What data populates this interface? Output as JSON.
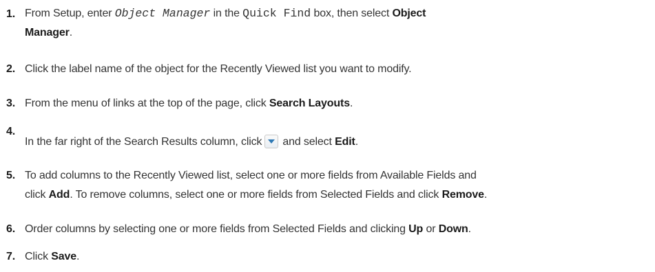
{
  "steps": [
    {
      "num": "1.",
      "line1": {
        "t1": "From Setup, enter ",
        "mono_italic": "Object Manager",
        "t2": " in the ",
        "mono": "Quick Find",
        "t3": " box, then select ",
        "bold": "Object"
      },
      "line2": {
        "bold": "Manager",
        "t1": "."
      }
    },
    {
      "num": "2.",
      "text": "Click the label name of the object for the Recently Viewed list you want to modify."
    },
    {
      "num": "3.",
      "t1": "From the menu of links at the top of the page, click ",
      "bold": "Search Layouts",
      "t2": "."
    },
    {
      "num": "4.",
      "t1": "In the far right of the Search Results column, click",
      "icon": "dropdown-arrow-icon",
      "t2": "and select ",
      "bold": "Edit",
      "t3": "."
    },
    {
      "num": "5.",
      "line1": {
        "t1": "To add columns to the Recently Viewed list, select one or more fields from Available Fields and"
      },
      "line2": {
        "t1": "click ",
        "bold1": "Add",
        "t2": ". To remove columns, select one or more fields from Selected Fields and click ",
        "bold2": "Remove",
        "t3": "."
      }
    },
    {
      "num": "6.",
      "t1": "Order columns by selecting one or more fields from Selected Fields and clicking ",
      "bold1": "Up",
      "t2": " or ",
      "bold2": "Down",
      "t3": "."
    },
    {
      "num": "7.",
      "t1": "Click ",
      "bold": "Save",
      "t2": "."
    }
  ]
}
